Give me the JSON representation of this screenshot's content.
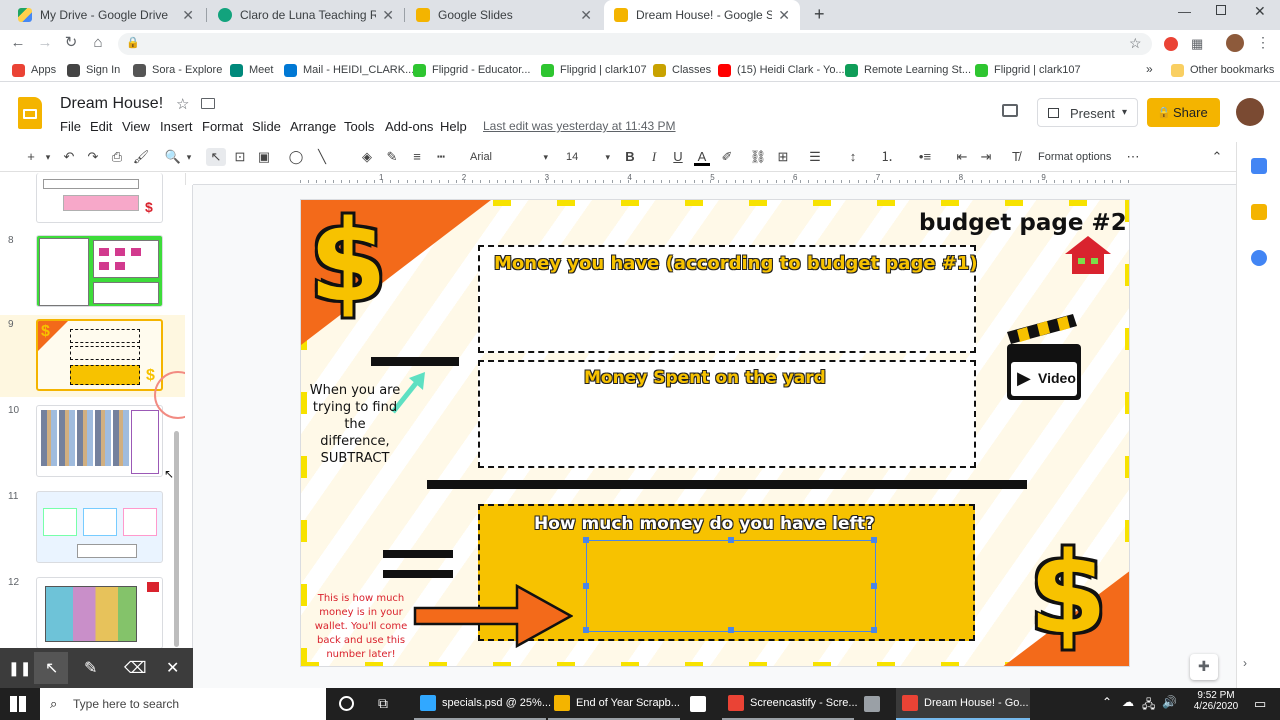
{
  "browser": {
    "tabs": [
      {
        "title": "My Drive - Google Drive",
        "color": "#1fa463"
      },
      {
        "title": "Claro de Luna Teaching Resource",
        "color": "#12a37d"
      },
      {
        "title": "Google Slides",
        "color": "#f4b400"
      },
      {
        "title": "Dream House! - Google Slides",
        "color": "#f4b400",
        "active": true
      }
    ],
    "new_tab": "+",
    "bookmarks": [
      {
        "label": "Apps",
        "color": "#ea4335"
      },
      {
        "label": "Sign In",
        "color": "#444444"
      },
      {
        "label": "Sora - Explore",
        "color": "#555555"
      },
      {
        "label": "Meet",
        "color": "#00897b"
      },
      {
        "label": "Mail - HEIDI_CLARK...",
        "color": "#0078d4"
      },
      {
        "label": "Flipgrid - Educator...",
        "color": "#2ec530"
      },
      {
        "label": "Flipgrid | clark107",
        "color": "#2ec530"
      },
      {
        "label": "Classes",
        "color": "#c8a200"
      },
      {
        "label": "(15) Heidi Clark - Yo...",
        "color": "#ff0000"
      },
      {
        "label": "Remote Learning St...",
        "color": "#0f9d58"
      },
      {
        "label": "Flipgrid | clark107",
        "color": "#2ec530"
      }
    ],
    "more": "»",
    "other_bookmarks": "Other bookmarks"
  },
  "doc": {
    "title": "Dream House!",
    "menu": [
      "File",
      "Edit",
      "View",
      "Insert",
      "Format",
      "Slide",
      "Arrange",
      "Tools",
      "Add-ons",
      "Help"
    ],
    "last_edit": "Last edit was yesterday at 11:43 PM",
    "present": "Present",
    "share": "Share"
  },
  "toolbar": {
    "font": "Arial",
    "size": "14",
    "format_options": "Format options"
  },
  "ruler": [
    "1",
    "2",
    "3",
    "4",
    "5",
    "6",
    "7",
    "8",
    "9"
  ],
  "filmstrip": [
    {
      "num": "",
      "kind": "pink"
    },
    {
      "num": "8",
      "kind": "yard"
    },
    {
      "num": "9",
      "kind": "budget",
      "selected": true
    },
    {
      "num": "10",
      "kind": "shop"
    },
    {
      "num": "11",
      "kind": "about"
    },
    {
      "num": "12",
      "kind": "plan"
    }
  ],
  "slide": {
    "heading": "budget page #2",
    "box1_title": "Money you have (according to budget page #1)",
    "box2_title": "Money Spent on the yard",
    "box3_title": "How much money do you have left?",
    "note_subtract": "When you are trying to find the difference, SUBTRACT",
    "note_wallet": "This is how much money is in your wallet. You'll come back and use this number later!",
    "video_label": "Video",
    "dollar": "$"
  },
  "taskbar": {
    "search": "Type here to search",
    "apps": [
      {
        "label": "specials.psd @ 25%...",
        "color": "#31a8ff"
      },
      {
        "label": "End of Year Scrapb...",
        "color": "#f4b400"
      },
      {
        "label": "",
        "color": "#ffffff"
      },
      {
        "label": "Screencastify - Scre...",
        "color": "#ea4335"
      },
      {
        "label": "",
        "color": "#9aa0a6"
      },
      {
        "label": "Dream House! - Go...",
        "color": "#ea4335"
      }
    ],
    "time": "9:52 PM",
    "date": "4/26/2020"
  }
}
